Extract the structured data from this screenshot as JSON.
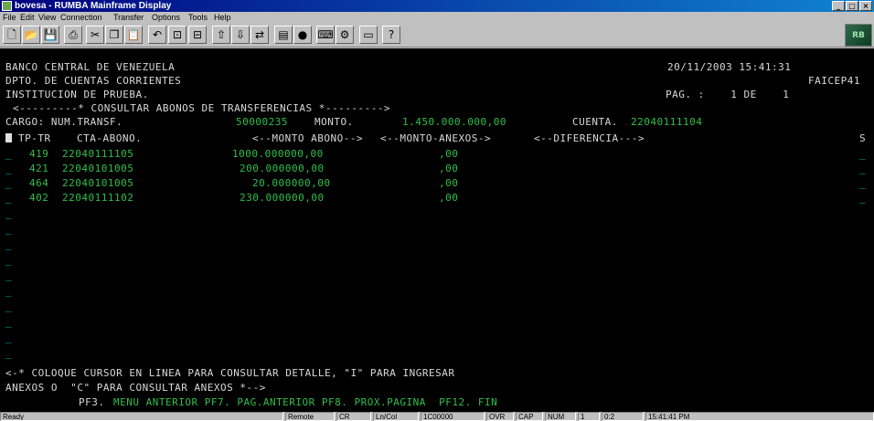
{
  "window": {
    "title": "bovesa - RUMBA Mainframe Display"
  },
  "menu": [
    "File",
    "Edit",
    "View",
    "Connection",
    "Transfer",
    "Options",
    "Tools",
    "Help"
  ],
  "toolbar": {
    "icons": [
      "new-icon",
      "open-icon",
      "save-icon",
      "print-icon",
      "cut-icon",
      "copy-icon",
      "paste-icon",
      "undo-icon",
      "connect-icon",
      "disconnect-icon",
      "upload-icon",
      "download-icon",
      "transfer-icon",
      "macro-icon",
      "record-icon",
      "keyboard-icon",
      "settings-icon",
      "help-icon"
    ]
  },
  "screen": {
    "header_left_1": "BANCO CENTRAL DE VENEZUELA",
    "header_right_1": "20/11/2003 15:41:31",
    "header_left_2": "DPTO. DE CUENTAS CORRIENTES",
    "header_right_2": "FAICEP41",
    "header_left_3": "INSTITUCION DE PRUEBA.",
    "header_right_3": "PAG. :    1 DE    1",
    "screen_title": "<---------* CONSULTAR ABONOS DE TRANSFERENCIAS *--------->",
    "cargo_label": "CARGO: NUM.TRANSF.",
    "num_transf": "50000235",
    "monto_label": "MONTO.",
    "monto_value": "1.450.000.000,00",
    "cuenta_label": "CUENTA.",
    "cuenta_value": "22040111104",
    "columns": {
      "tp_tr": "TP-TR",
      "cta_abono": "CTA-ABONO.",
      "monto_abono": "<--MONTO ABONO-->",
      "monto_anexos": "<--MONTO-ANEXOS->",
      "diferencia": "<--DIFERENCIA--->",
      "s": "S"
    },
    "rows": [
      {
        "tp": "419",
        "cta": "22040111105",
        "monto": "1000.000000,00",
        "anexos": ",00"
      },
      {
        "tp": "421",
        "cta": "22040101005",
        "monto": "200.000000,00",
        "anexos": ",00"
      },
      {
        "tp": "464",
        "cta": "22040101005",
        "monto": "20.000000,00",
        "anexos": ",00"
      },
      {
        "tp": "402",
        "cta": "22040111102",
        "monto": "230.000000,00",
        "anexos": ",00"
      }
    ],
    "footer_1": "<-* COLOQUE CURSOR EN LINEA PARA CONSULTAR DETALLE, \"I\" PARA INGRESAR",
    "footer_2": "ANEXOS O  \"C\" PARA CONSULTAR ANEXOS *-->",
    "footer_3_pf3": "PF3.",
    "footer_3_rest": "MENU ANTERIOR PF7. PAG.ANTERIOR PF8. PROX.PAGINA  PF12. FIN"
  },
  "status": {
    "ready": "Ready",
    "session": "Remote",
    "seg2": "CR",
    "seg3": "Ln/Col",
    "lu": "1C00000",
    "ovr": "OVR",
    "cap": "CAP",
    "num": "NUM",
    "seg8": "1",
    "seg9": "0:2",
    "time": "15:41:41 PM"
  }
}
